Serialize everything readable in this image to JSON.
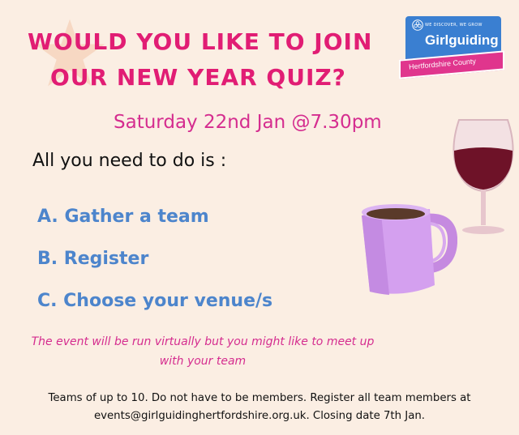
{
  "headline": {
    "line1": "Would you like to join",
    "line2": "our New Year quiz?"
  },
  "logo": {
    "tagline": "WE DISCOVER, WE GROW",
    "name": "Girlguiding",
    "county": "Hertfordshire County"
  },
  "event_date": "Saturday 22nd Jan @7.30pm",
  "intro": "All you need to do is :",
  "steps": [
    "A. Gather a team",
    "B. Register",
    "C. Choose your venue/s"
  ],
  "note": "The event will be run virtually but you might like to meet up with your team",
  "footer": {
    "line1": "Teams of up to 10. Do not have to be members. Register all team members at",
    "line2": "events@girlguidinghertfordshire.org.uk. Closing date 7th Jan."
  },
  "colors": {
    "background": "#fbeee3",
    "headline": "#e11d74",
    "accent_pink": "#d52d8f",
    "steps_blue": "#4d85cc",
    "logo_blue": "#3a7fd1"
  },
  "icons": [
    "star-decoration-icon",
    "trefoil-icon",
    "wine-glass-icon",
    "coffee-mug-icon"
  ]
}
